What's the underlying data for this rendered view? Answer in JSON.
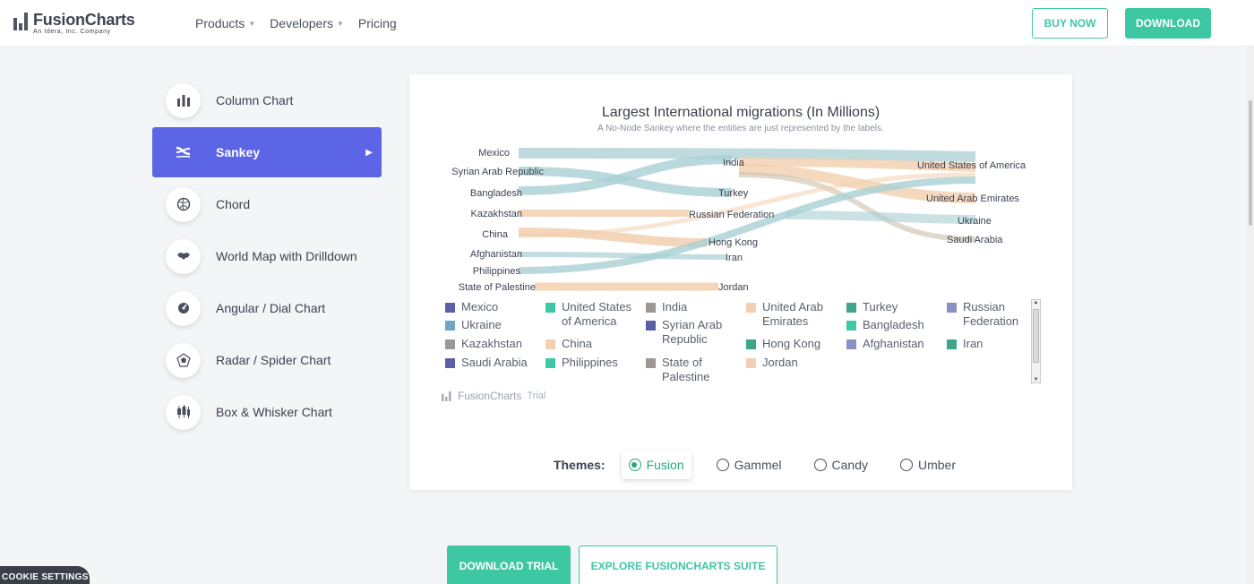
{
  "header": {
    "logo_name": "FusionCharts",
    "logo_sub": "An Idera, Inc. Company",
    "nav": [
      {
        "label": "Products",
        "dropdown": true
      },
      {
        "label": "Developers",
        "dropdown": true
      },
      {
        "label": "Pricing",
        "dropdown": false
      }
    ],
    "buy_now": "BUY NOW",
    "download": "DOWNLOAD"
  },
  "sidebar": {
    "items": [
      {
        "label": "Column Chart",
        "icon": "column-chart-icon",
        "active": false
      },
      {
        "label": "Sankey",
        "icon": "sankey-icon",
        "active": true
      },
      {
        "label": "Chord",
        "icon": "chord-icon",
        "active": false
      },
      {
        "label": "World Map with Drilldown",
        "icon": "world-map-icon",
        "active": false
      },
      {
        "label": "Angular / Dial Chart",
        "icon": "dial-chart-icon",
        "active": false
      },
      {
        "label": "Radar / Spider Chart",
        "icon": "radar-chart-icon",
        "active": false
      },
      {
        "label": "Box & Whisker Chart",
        "icon": "box-whisker-icon",
        "active": false
      }
    ]
  },
  "chart": {
    "title": "Largest International migrations (In Millions)",
    "subtitle": "A No-Node Sankey where the entities are just represented by the labels.",
    "credit": "FusionCharts",
    "credit_trial": "Trial"
  },
  "chart_data": {
    "type": "sankey",
    "title": "Largest International migrations (In Millions)",
    "subtitle": "A No-Node Sankey where the entities are just represented by the labels.",
    "source_nodes": [
      "Mexico",
      "Syrian Arab Republic",
      "Bangladesh",
      "Kazakhstan",
      "China",
      "Afghanistan",
      "Philippines",
      "State of Palestine"
    ],
    "middle_nodes": [
      "India",
      "Turkey",
      "Russian Federation",
      "Hong Kong",
      "Iran",
      "Jordan"
    ],
    "target_nodes": [
      "United States of America",
      "United Arab Emirates",
      "Ukraine",
      "Saudi Arabia"
    ],
    "links": [
      {
        "from": "Mexico",
        "to": "United States of America",
        "color": "#a9cfd3"
      },
      {
        "from": "Syrian Arab Republic",
        "to": "Turkey",
        "color": "#a9cfd3"
      },
      {
        "from": "Bangladesh",
        "to": "India",
        "color": "#a9cfd3"
      },
      {
        "from": "Kazakhstan",
        "to": "Russian Federation",
        "color": "#f2cfae"
      },
      {
        "from": "China",
        "to": "Hong Kong",
        "color": "#f2cfae"
      },
      {
        "from": "China",
        "to": "United States of America",
        "color": "#f2cfae"
      },
      {
        "from": "Afghanistan",
        "to": "Iran",
        "color": "#a9cfd3"
      },
      {
        "from": "Philippines",
        "to": "United States of America",
        "color": "#a9cfd3"
      },
      {
        "from": "State of Palestine",
        "to": "Jordan",
        "color": "#f2cfae"
      },
      {
        "from": "India",
        "to": "United States of America",
        "color": "#f2cfae"
      },
      {
        "from": "India",
        "to": "United Arab Emirates",
        "color": "#f2cfae"
      },
      {
        "from": "India",
        "to": "Saudi Arabia",
        "color": "#c9bfae"
      },
      {
        "from": "Russian Federation",
        "to": "Ukraine",
        "color": "#a9cfd3"
      }
    ]
  },
  "legend": [
    {
      "label": "Mexico",
      "color": "#5a5fa8",
      "col": 0,
      "row": 0
    },
    {
      "label": "Ukraine",
      "color": "#6fa6c4",
      "col": 0,
      "row": 1
    },
    {
      "label": "Kazakhstan",
      "color": "#9c9894",
      "col": 0,
      "row": 2
    },
    {
      "label": "Saudi Arabia",
      "color": "#5a5fa8",
      "col": 0,
      "row": 3
    },
    {
      "label": "United States of America",
      "color": "#3ec7a3",
      "col": 1,
      "row": 0
    },
    {
      "label": "China",
      "color": "#f2cfae",
      "col": 1,
      "row": 2
    },
    {
      "label": "Philippines",
      "color": "#3ec7a3",
      "col": 1,
      "row": 3
    },
    {
      "label": "India",
      "color": "#9c9894",
      "col": 2,
      "row": 0
    },
    {
      "label": "Syrian Arab Republic",
      "color": "#5a5fa8",
      "col": 2,
      "row": 1
    },
    {
      "label": "State of Palestine",
      "color": "#9c9894",
      "col": 2,
      "row": 3
    },
    {
      "label": "United Arab Emirates",
      "color": "#f2cfae",
      "col": 3,
      "row": 0
    },
    {
      "label": "Hong Kong",
      "color": "#3ea58a",
      "col": 3,
      "row": 2
    },
    {
      "label": "Jordan",
      "color": "#f2cfae",
      "col": 3,
      "row": 3
    },
    {
      "label": "Turkey",
      "color": "#3ea58a",
      "col": 4,
      "row": 0
    },
    {
      "label": "Bangladesh",
      "color": "#3ec7a3",
      "col": 4,
      "row": 1
    },
    {
      "label": "Afghanistan",
      "color": "#8a8fc4",
      "col": 4,
      "row": 2
    },
    {
      "label": "Russian Federation",
      "color": "#8a8fc4",
      "col": 5,
      "row": 0
    },
    {
      "label": "Iran",
      "color": "#3ea58a",
      "col": 5,
      "row": 2
    }
  ],
  "themes": {
    "label": "Themes:",
    "options": [
      "Fusion",
      "Gammel",
      "Candy",
      "Umber"
    ],
    "selected": "Fusion"
  },
  "bottom": {
    "download_trial": "DOWNLOAD TRIAL",
    "explore": "EXPLORE FUSIONCHARTS SUITE",
    "cookie": "COOKIE SETTINGS"
  }
}
